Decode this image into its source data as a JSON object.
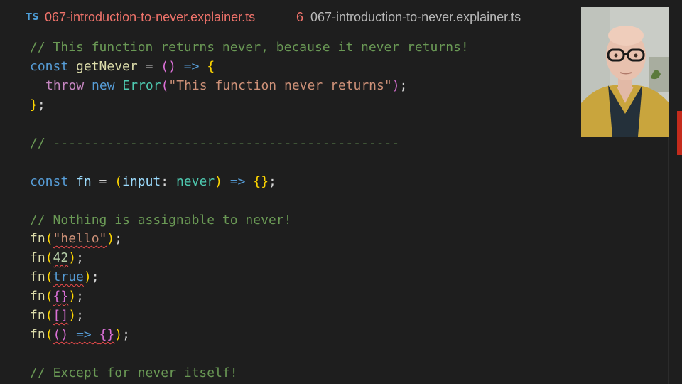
{
  "tab": {
    "badge": "TS",
    "filename": "067-introduction-to-never.explainer.ts",
    "problem_count": "6",
    "breadcrumb": "067-introduction-to-never.explainer.ts"
  },
  "code": {
    "l1_comment": "// This function returns never, because it never returns!",
    "l2_const": "const",
    "l2_name": "getNever",
    "l2_eq": " = ",
    "l2_parens": "()",
    "l2_arrow": "=>",
    "l2_brace": "{",
    "l3_throw": "throw",
    "l3_new": "new",
    "l3_error": "Error",
    "l3_open": "(",
    "l3_msg": "\"This function never returns\"",
    "l3_close": ")",
    "l3_semi": ";",
    "l4_brace": "}",
    "l4_semi": ";",
    "l5_comment": "// ---------------------------------------------",
    "l6_const": "const",
    "l6_name": "fn",
    "l6_eq": " = ",
    "l6_open": "(",
    "l6_param": "input",
    "l6_colon": ": ",
    "l6_type": "never",
    "l6_close": ")",
    "l6_arrow": "=>",
    "l6_body": "{}",
    "l6_semi": ";",
    "l7_comment": "// Nothing is assignable to never!",
    "fn": "fn",
    "open": "(",
    "close": ")",
    "semi": ";",
    "arg_hello": "\"hello\"",
    "arg_42": "42",
    "arg_true": "true",
    "arg_obj": "{}",
    "arg_arr": "[]",
    "arg_fn_parens": "()",
    "arg_fn_arrow": "=>",
    "arg_fn_body": "{}",
    "l14_comment": "// Except for never itself!"
  },
  "colors": {
    "background": "#1e1e1e",
    "error_tab": "#f0736b",
    "error_marker": "#c42b1c"
  }
}
